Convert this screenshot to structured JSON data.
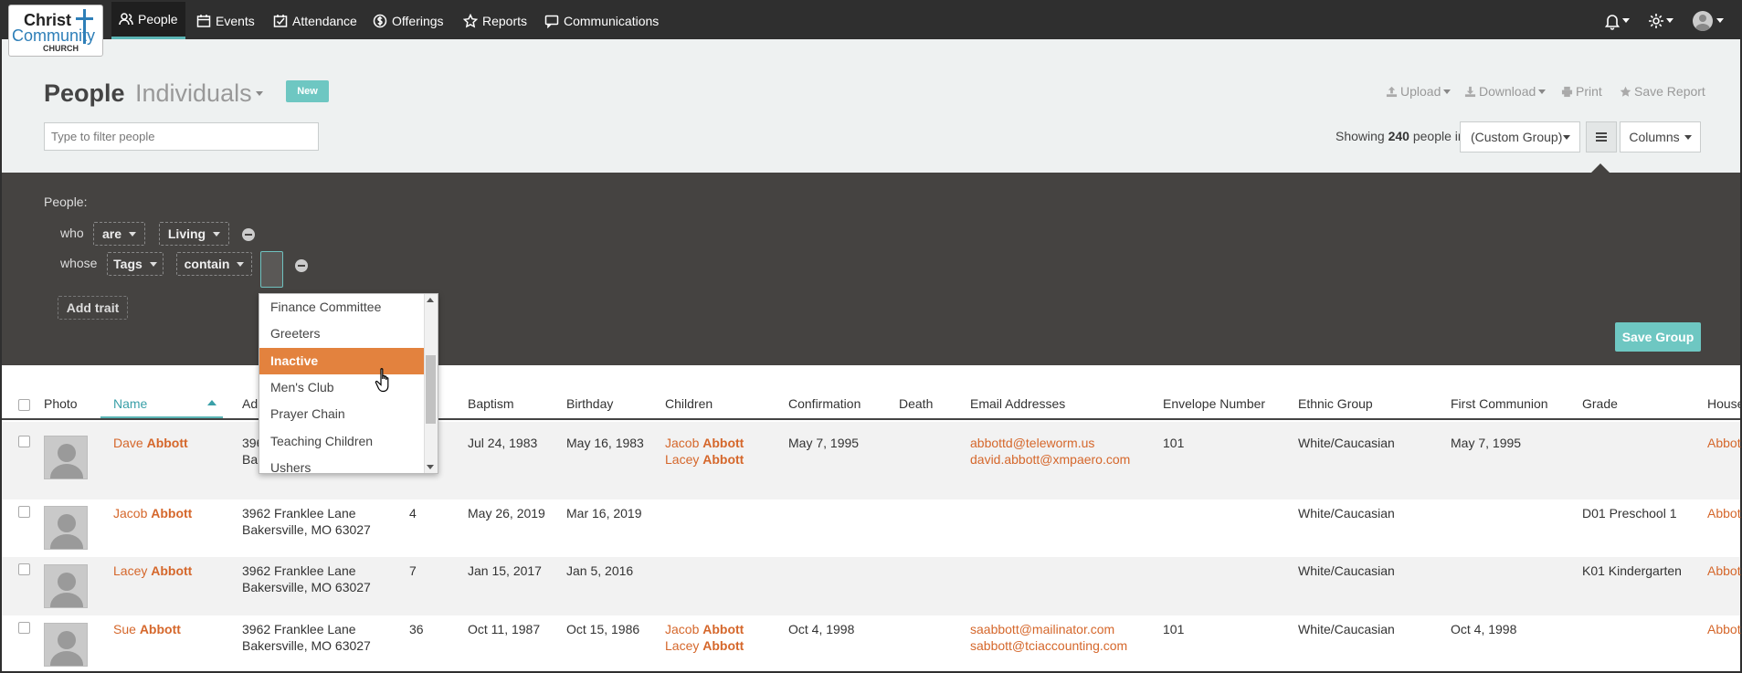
{
  "app": {
    "logo": {
      "line1": "Christ",
      "line2": "Community",
      "line3": "CHURCH"
    },
    "nav": [
      {
        "label": "People",
        "icon": "people-icon"
      },
      {
        "label": "Events",
        "icon": "calendar-icon"
      },
      {
        "label": "Attendance",
        "icon": "attendance-icon"
      },
      {
        "label": "Offerings",
        "icon": "offerings-icon"
      },
      {
        "label": "Reports",
        "icon": "star-icon"
      },
      {
        "label": "Communications",
        "icon": "chat-icon"
      }
    ]
  },
  "header": {
    "title": "People",
    "subtitle": "Individuals",
    "new_label": "New",
    "filter_placeholder": "Type to filter people",
    "actions": {
      "upload": "Upload",
      "download": "Download",
      "print": "Print",
      "save_report": "Save Report"
    },
    "showing_prefix": "Showing",
    "showing_count": "240",
    "showing_suffix": "people in",
    "group_select": "(Custom Group)",
    "columns_label": "Columns"
  },
  "filter": {
    "label": "People:",
    "row1": {
      "word": "who",
      "op": "are",
      "value": "Living"
    },
    "row2": {
      "word": "whose",
      "field": "Tags",
      "op": "contain"
    },
    "add_trait": "Add trait",
    "save_group": "Save Group"
  },
  "dropdown": {
    "items": [
      "Finance Committee",
      "Greeters",
      "Inactive",
      "Men's Club",
      "Prayer Chain",
      "Teaching Children",
      "Ushers"
    ],
    "selected": "Inactive"
  },
  "table": {
    "headers": {
      "photo": "Photo",
      "name": "Name",
      "address": "Ad",
      "baptism": "Baptism",
      "birthday": "Birthday",
      "children": "Children",
      "confirmation": "Confirmation",
      "death": "Death",
      "emails": "Email Addresses",
      "envelope": "Envelope Number",
      "ethnic": "Ethnic Group",
      "first_communion": "First Communion",
      "grade": "Grade",
      "household": "House"
    },
    "rows": [
      {
        "first": "Dave",
        "last": "Abbott",
        "addr1": "396",
        "addr2": "Bak",
        "age": "",
        "baptism": "Jul 24, 1983",
        "birthday": "May 16, 1983",
        "child1_first": "Jacob",
        "child1_last": "Abbott",
        "child2_first": "Lacey",
        "child2_last": "Abbott",
        "confirmation": "May 7, 1995",
        "email1": "abbottd@teleworm.us",
        "email2": "david.abbott@xmpaero.com",
        "envelope": "101",
        "ethnic": "White/Caucasian",
        "first_communion": "May 7, 1995",
        "grade": "",
        "household": "Abbot"
      },
      {
        "first": "Jacob",
        "last": "Abbott",
        "addr1": "3962 Franklee Lane",
        "addr2": "Bakersville, MO  63027",
        "age": "4",
        "baptism": "May 26, 2019",
        "birthday": "Mar 16, 2019",
        "envelope": "",
        "ethnic": "White/Caucasian",
        "first_communion": "",
        "grade": "D01 Preschool 1",
        "household": "Abbot"
      },
      {
        "first": "Lacey",
        "last": "Abbott",
        "addr1": "3962 Franklee Lane",
        "addr2": "Bakersville, MO  63027",
        "age": "7",
        "baptism": "Jan 15, 2017",
        "birthday": "Jan 5, 2016",
        "envelope": "",
        "ethnic": "White/Caucasian",
        "first_communion": "",
        "grade": "K01 Kindergarten",
        "household": "Abbot"
      },
      {
        "first": "Sue",
        "last": "Abbott",
        "addr1": "3962 Franklee Lane",
        "addr2": "Bakersville, MO  63027",
        "age": "36",
        "baptism": "Oct 11, 1987",
        "birthday": "Oct 15, 1986",
        "child1_first": "Jacob",
        "child1_last": "Abbott",
        "child2_first": "Lacey",
        "child2_last": "Abbott",
        "confirmation": "Oct 4, 1998",
        "email1": "saabbott@mailinator.com",
        "email2": "sabbott@tciaccounting.com",
        "envelope": "101",
        "ethnic": "White/Caucasian",
        "first_communion": "Oct 4, 1998",
        "grade": "",
        "household": "Abbot"
      }
    ]
  },
  "colors": {
    "accent": "#6ec7c2",
    "link": "#d5672b",
    "nav_bg": "#2f2f2f",
    "panel_bg": "#454341",
    "selected": "#e3823e"
  }
}
